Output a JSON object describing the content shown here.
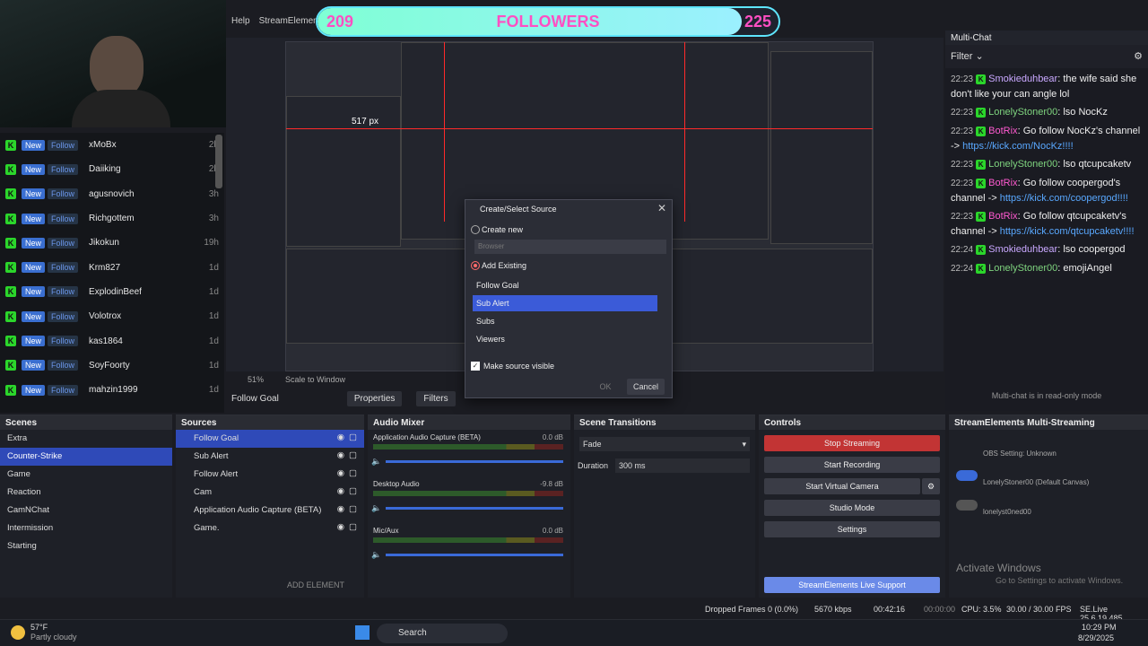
{
  "menu": [
    "Help",
    "StreamElements"
  ],
  "follower_goal": {
    "current": "209",
    "title": "FOLLOWERS",
    "target": "225",
    "progress": 0.92
  },
  "follow_list": [
    {
      "badge": "New",
      "badge2": "Follow",
      "name": "xMoBx",
      "time": "2h"
    },
    {
      "badge": "New",
      "badge2": "Follow",
      "name": "Daiiking",
      "time": "2h"
    },
    {
      "badge": "New",
      "badge2": "Follow",
      "name": "agusnovich",
      "time": "3h"
    },
    {
      "badge": "New",
      "badge2": "Follow",
      "name": "Richgottem",
      "time": "3h"
    },
    {
      "badge": "New",
      "badge2": "Follow",
      "name": "Jikokun",
      "time": "19h"
    },
    {
      "badge": "New",
      "badge2": "Follow",
      "name": "Krm827",
      "time": "1d"
    },
    {
      "badge": "New",
      "badge2": "Follow",
      "name": "ExplodinBeef",
      "time": "1d"
    },
    {
      "badge": "New",
      "badge2": "Follow",
      "name": "Volotrox",
      "time": "1d"
    },
    {
      "badge": "New",
      "badge2": "Follow",
      "name": "kas1864",
      "time": "1d"
    },
    {
      "badge": "New",
      "badge2": "Follow",
      "name": "SoyFoorty",
      "time": "1d"
    },
    {
      "badge": "New",
      "badge2": "Follow",
      "name": "mahzin1999",
      "time": "1d"
    }
  ],
  "preview": {
    "size_label": "517 px",
    "scale_label": "Scale to Window",
    "zoom": "51%"
  },
  "dialog": {
    "title": "Create/Select Source",
    "create_new": "Create new",
    "input_placeholder": "Browser",
    "add_existing": "Add Existing",
    "options": [
      "Follow Goal",
      "Sub Alert",
      "Subs",
      "Viewers"
    ],
    "make_visible": "Make source visible",
    "ok": "OK",
    "cancel": "Cancel"
  },
  "multichat": {
    "title": "Multi-Chat",
    "filter": "Filter",
    "footer": "Multi-chat is in read-only mode",
    "messages": [
      {
        "time": "22:23",
        "user": "Smokieduhbear",
        "color": "#c9a8ff",
        "text": "the wife said she don't like your can angle lol",
        "link": ""
      },
      {
        "time": "22:23",
        "user": "LonelyStoner00",
        "color": "#7fd47f",
        "text": "lso NocKz",
        "link": ""
      },
      {
        "time": "22:23",
        "user": "BotRix",
        "color": "#ff5ad0",
        "text": "Go follow NocKz's channel ->",
        "link": "https://kick.com/NocKz!!!!"
      },
      {
        "time": "22:23",
        "user": "LonelyStoner00",
        "color": "#7fd47f",
        "text": "lso qtcupcaketv",
        "link": ""
      },
      {
        "time": "22:23",
        "user": "BotRix",
        "color": "#ff5ad0",
        "text": "Go follow coopergod's channel ->",
        "link": "https://kick.com/coopergod!!!!"
      },
      {
        "time": "22:23",
        "user": "BotRix",
        "color": "#ff5ad0",
        "text": "Go follow qtcupcaketv's channel ->",
        "link": "https://kick.com/qtcupcaketv!!!!"
      },
      {
        "time": "22:24",
        "user": "Smokieduhbear",
        "color": "#c9a8ff",
        "text": "lso coopergod",
        "link": ""
      },
      {
        "time": "22:24",
        "user": "LonelyStoner00",
        "color": "#7fd47f",
        "text": "emojiAngel",
        "link": ""
      }
    ]
  },
  "source_toolbar": {
    "source": "Follow Goal",
    "properties": "Properties",
    "filters": "Filters"
  },
  "scenes": {
    "title": "Scenes",
    "items": [
      "Extra",
      "Counter-Strike",
      "Game",
      "Reaction",
      "CamNChat",
      "Intermission",
      "Starting"
    ],
    "selected": 1
  },
  "sources": {
    "title": "Sources",
    "items": [
      "Follow Goal",
      "Sub Alert",
      "Follow Alert",
      "Cam",
      "Application Audio Capture (BETA)",
      "Game."
    ],
    "add_element": "ADD ELEMENT"
  },
  "mixer": {
    "title": "Audio Mixer",
    "channels": [
      {
        "name": "Application Audio Capture (BETA)",
        "db": "0.0 dB"
      },
      {
        "name": "Desktop Audio",
        "db": "-9.8 dB"
      },
      {
        "name": "Mic/Aux",
        "db": "0.0 dB"
      }
    ]
  },
  "transitions": {
    "title": "Scene Transitions",
    "type": "Fade",
    "duration_label": "Duration",
    "duration": "300 ms"
  },
  "controls": {
    "title": "Controls",
    "stop": "Stop Streaming",
    "record": "Start Recording",
    "virtual": "Start Virtual Camera",
    "studio": "Studio Mode",
    "settings": "Settings",
    "support": "StreamElements Live Support"
  },
  "se_multi": {
    "title": "StreamElements Multi-Streaming",
    "rows": [
      "OBS Setting: Unknown",
      "LonelyStoner00 (Default Canvas)",
      "lonelyst0ned00"
    ]
  },
  "activate": {
    "title": "Activate Windows",
    "sub": "Go to Settings to activate Windows."
  },
  "status": {
    "dropped": "Dropped Frames 0 (0.0%)",
    "kbps": "5670 kbps",
    "live": "00:42:16",
    "rec": "00:00:00",
    "cpu": "CPU: 3.5%",
    "fps": "30.00 / 30.00 FPS",
    "se": "SE.Live 25.6.19.485"
  },
  "taskbar": {
    "weather_temp": "57°F",
    "weather_desc": "Partly cloudy",
    "search": "Search",
    "time": "10:29 PM",
    "date": "8/29/2025"
  }
}
